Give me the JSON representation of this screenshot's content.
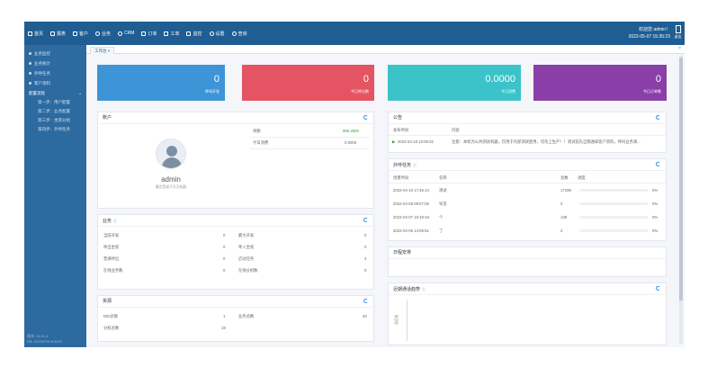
{
  "topbar": {
    "nav": [
      {
        "label": "首页",
        "icon": "home-icon"
      },
      {
        "label": "报表",
        "icon": "chart-icon"
      },
      {
        "label": "客户",
        "icon": "id-card-icon"
      },
      {
        "label": "业务",
        "icon": "gear-icon"
      },
      {
        "label": "CRM",
        "icon": "cloud-icon"
      },
      {
        "label": "订单",
        "icon": "cart-icon"
      },
      {
        "label": "工单",
        "icon": "ticket-icon"
      },
      {
        "label": "监控",
        "icon": "monitor-icon"
      },
      {
        "label": "设置",
        "icon": "settings-icon"
      },
      {
        "label": "查询",
        "icon": "search-icon"
      }
    ],
    "welcome": "欢迎您 admin！",
    "datetime": "2022-05-07 15:35:23",
    "exit_label": "退出"
  },
  "sidebar": {
    "items": [
      {
        "label": "业务监控"
      },
      {
        "label": "业务统计"
      },
      {
        "label": "外呼任务"
      },
      {
        "label": "客户资料"
      }
    ],
    "group_label": "配置流程",
    "group_arrow": "⌄",
    "sub_items": [
      {
        "label": "第一步：用户配置"
      },
      {
        "label": "第二步：业务配置"
      },
      {
        "label": "第三步：坐席分组"
      },
      {
        "label": "第四步：外呼任务"
      }
    ],
    "version": "版本: 24.11.4",
    "build": "DB: 20190706    8.0022"
  },
  "tabs": {
    "active": "工作台",
    "close": "×"
  },
  "stats": [
    {
      "value": "0",
      "label": "呼叫开发",
      "color": "#3d95d7"
    },
    {
      "value": "0",
      "label": "今日呼出数",
      "color": "#e45463"
    },
    {
      "value": "0.0000",
      "label": "今日消费",
      "color": "#3bc3c9"
    },
    {
      "value": "0",
      "label": "今日订单数",
      "color": "#8a3fa8"
    }
  ],
  "account": {
    "title": "账户",
    "username": "admin",
    "note": "最近登录于天天机器",
    "rows": [
      {
        "label": "余额",
        "value": "960.2500"
      },
      {
        "label": "今日消费",
        "value": "0.0000"
      }
    ]
  },
  "business": {
    "title": "业务",
    "tag": "ⓒ",
    "rows": [
      {
        "l1": "当前开发",
        "v1": "0",
        "l2": "最大开发",
        "v2": "0"
      },
      {
        "l1": "呼出坐席",
        "v1": "0",
        "l2": "呼入坐席",
        "v2": "0"
      },
      {
        "l1": "普通呼出",
        "v1": "0",
        "l2": "启动任务",
        "v2": "4"
      },
      {
        "l1": "在线业务数",
        "v1": "0",
        "l2": "在线分机数",
        "v2": "0"
      }
    ]
  },
  "resources": {
    "title": "资源",
    "rows": [
      {
        "l1": "DID总数",
        "v1": "1",
        "l2": "业务总数",
        "v2": "40"
      },
      {
        "l1": "分机总数",
        "v1": "19"
      }
    ]
  },
  "notice": {
    "title": "公告",
    "cols": [
      "发布时间",
      "内容"
    ],
    "rows": [
      {
        "time": "2022-04-18 10:05:02",
        "content": "注意：本机为公共测试机器，仅用于内部测试使用，切勿上生产！！测试前先自我通知客户资料，呼叫业务请..."
      }
    ]
  },
  "tasks": {
    "title": "外呼任务",
    "tag": "ⓒ",
    "cols": [
      "创建时间",
      "名称",
      "总数",
      "进度"
    ],
    "rows": [
      {
        "time": "2022-04-10 17:46:14",
        "name": "测试",
        "total": "17199",
        "progress": "0%",
        "ratio": 0
      },
      {
        "time": "2022-04-08 08:07:06",
        "name": "导流",
        "total": "2",
        "progress": "0%",
        "ratio": 0
      },
      {
        "time": "2022-04-07 10:19:18",
        "name": "个",
        "total": "138",
        "progress": "0%",
        "ratio": 0
      },
      {
        "time": "2022-04-06 14:09:51",
        "name": "了",
        "total": "2",
        "progress": "0%",
        "ratio": 0
      }
    ]
  },
  "schedule": {
    "title": "日程安排"
  },
  "recent": {
    "title": "近期通话趋势",
    "tag": "ⓒ",
    "ylabel": "通话量"
  }
}
